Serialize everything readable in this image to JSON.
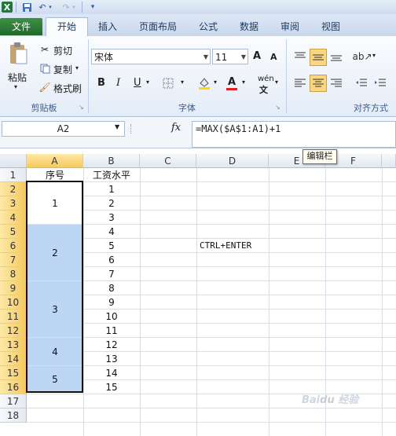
{
  "quick_access": {
    "icons": [
      "excel-logo",
      "save-icon",
      "undo-icon",
      "redo-icon",
      "customize-icon"
    ]
  },
  "tabs": [
    "文件",
    "开始",
    "插入",
    "页面布局",
    "公式",
    "数据",
    "审阅",
    "视图"
  ],
  "ribbon": {
    "clipboard": {
      "paste": "粘贴",
      "cut": "剪切",
      "copy": "复制",
      "format_painter": "格式刷",
      "group": "剪贴板"
    },
    "font": {
      "font_name": "宋体",
      "font_size": "11",
      "bold": "B",
      "italic": "I",
      "underline": "U",
      "grow": "A",
      "shrink": "A",
      "phonetic": "wén",
      "group": "字体"
    },
    "alignment": {
      "group": "对齐方式"
    }
  },
  "formula_bar": {
    "name_box": "A2",
    "fx": "fx",
    "formula": "=MAX($A$1:A1)+1",
    "tooltip": "编辑栏"
  },
  "sheet": {
    "columns": [
      "A",
      "B",
      "C",
      "D",
      "E",
      "F"
    ],
    "rows": [
      "1",
      "2",
      "3",
      "4",
      "5",
      "6",
      "7",
      "8",
      "9",
      "10",
      "11",
      "12",
      "13",
      "14",
      "15",
      "16",
      "17",
      "18"
    ],
    "header_a": "序号",
    "header_b": "工资水平",
    "merged_a": [
      "1",
      "2",
      "3",
      "4",
      "5"
    ],
    "col_b": [
      "1",
      "2",
      "3",
      "4",
      "5",
      "6",
      "7",
      "8",
      "9",
      "10",
      "11",
      "12",
      "13",
      "14",
      "15"
    ],
    "note": "CTRL+ENTER"
  },
  "colors": {
    "selection": "#bcd6f4",
    "selected_header": "#f6c95d",
    "file_tab": "#2b7a35"
  },
  "watermark": "Baidu经验"
}
